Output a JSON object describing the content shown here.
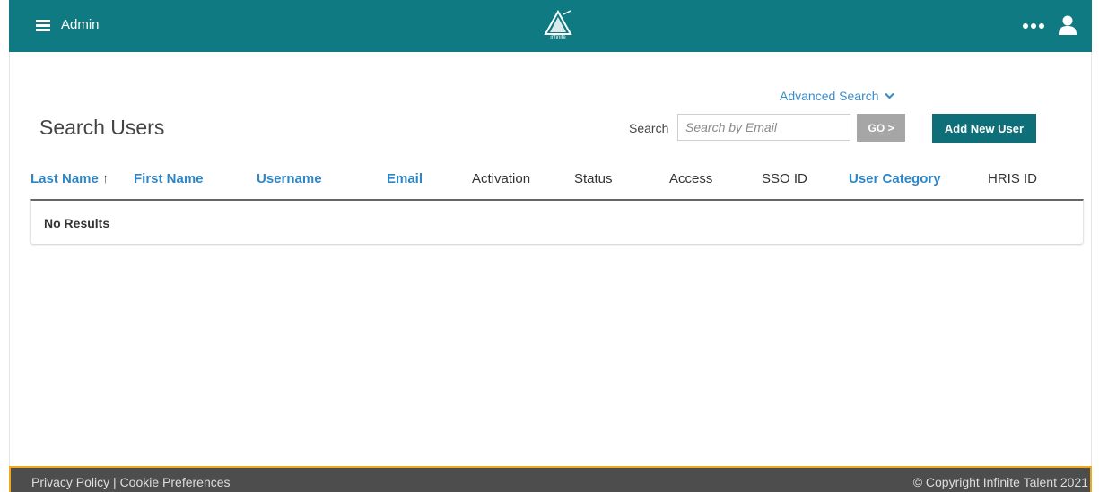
{
  "header": {
    "app_name": "Admin",
    "logo_text": "infinite",
    "accent_color": "#0f7a82"
  },
  "page": {
    "title": "Search Users"
  },
  "search": {
    "advanced_label": "Advanced Search",
    "label": "Search",
    "placeholder": "Search by Email",
    "value": "",
    "go_label": "GO >",
    "add_user_label": "Add New User"
  },
  "table": {
    "columns": [
      {
        "label": "Last Name",
        "sortable": true,
        "sort": "asc"
      },
      {
        "label": "First Name",
        "sortable": true
      },
      {
        "label": "Username",
        "sortable": true
      },
      {
        "label": "Email",
        "sortable": true
      },
      {
        "label": "Activation",
        "sortable": false
      },
      {
        "label": "Status",
        "sortable": false
      },
      {
        "label": "Access",
        "sortable": false
      },
      {
        "label": "SSO ID",
        "sortable": false
      },
      {
        "label": "User Category",
        "sortable": true
      },
      {
        "label": "HRIS ID",
        "sortable": false
      }
    ],
    "sort_indicator": "↑",
    "empty_message": "No Results"
  },
  "footer": {
    "privacy_label": "Privacy Policy",
    "separator": "|",
    "cookie_label": "Cookie Preferences",
    "copyright": "© Copyright Infinite Talent 2021"
  }
}
